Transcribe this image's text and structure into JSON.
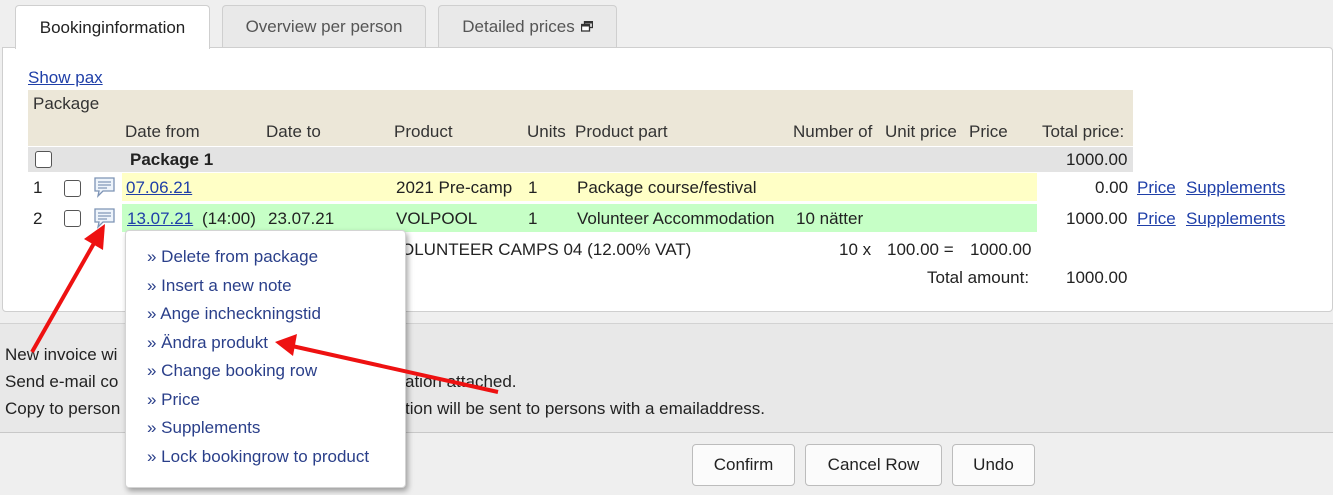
{
  "tabs": [
    {
      "label": "Bookinginformation",
      "active": true
    },
    {
      "label": "Overview per person",
      "active": false
    },
    {
      "label": "Detailed prices",
      "active": false,
      "icon": "external-window-icon"
    }
  ],
  "show_pax": "Show pax",
  "section_title": "Package",
  "columns": {
    "date_from": "Date from",
    "date_to": "Date to",
    "product": "Product",
    "units": "Units",
    "product_part": "Product part",
    "number_of": "Number of",
    "unit_price": "Unit price",
    "price": "Price",
    "total_price": "Total price:"
  },
  "package": {
    "name": "Package 1",
    "total": "1000.00"
  },
  "rows": [
    {
      "no": "1",
      "date_from": "07.06.21",
      "time": "",
      "date_to": "",
      "product": "2021 Pre-camp",
      "units": "1",
      "product_part": "Package course/festival",
      "number_of": "",
      "total": "0.00",
      "price_link": "Price",
      "supplements_link": "Supplements"
    },
    {
      "no": "2",
      "date_from": "13.07.21",
      "time": "(14:00)",
      "date_to": "23.07.21",
      "product": "VOLPOOL",
      "units": "1",
      "product_part": "Volunteer Accommodation",
      "number_of": "10 nätter",
      "total": "1000.00",
      "price_link": "Price",
      "supplements_link": "Supplements"
    }
  ],
  "detail_line": {
    "text": "OLUNTEER CAMPS 04 (12.00% VAT)",
    "qty": "10 x",
    "unit": "100.00 =",
    "amount": "1000.00"
  },
  "total_amount": {
    "label": "Total amount:",
    "value": "1000.00"
  },
  "lower": {
    "line1": "New invoice wi",
    "line2a": "Send e-mail co",
    "line2b": "ation attached.",
    "line3a": "Copy to person",
    "line3b": "tion will be sent to persons with a emailaddress."
  },
  "context_menu": [
    "» Delete from package",
    "» Insert a new note",
    "» Ange incheckningstid",
    "» Ändra produkt",
    "» Change booking row",
    "» Price",
    "» Supplements",
    "» Lock bookingrow to product"
  ],
  "buttons": {
    "confirm": "Confirm",
    "cancel_row": "Cancel Row",
    "undo": "Undo"
  },
  "colors": {
    "annotation_arrow": "#ee1111",
    "link": "#1f3fa8",
    "menu_text": "#2a3f8a",
    "row1_bg": "#ffffc6",
    "row2_bg": "#c6ffc6",
    "header_bg": "#ece7d8"
  }
}
